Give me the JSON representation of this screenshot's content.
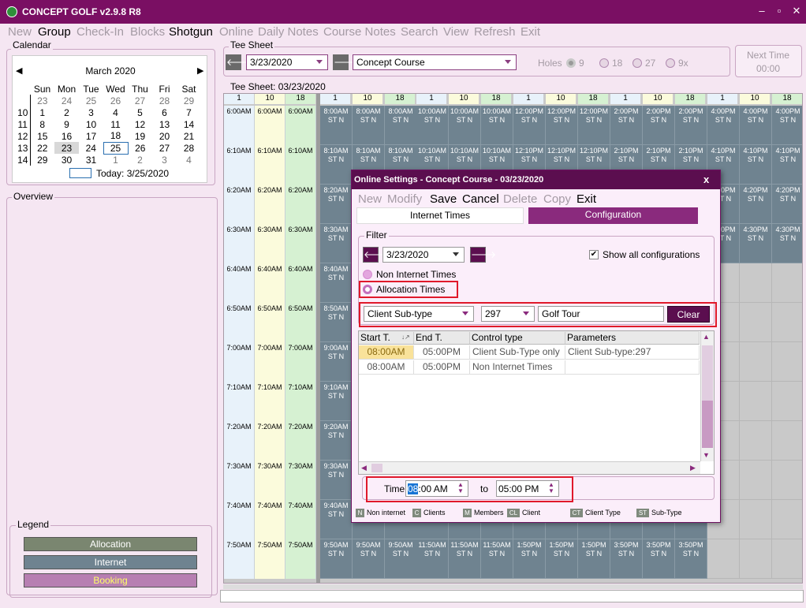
{
  "app": {
    "title": "CONCEPT GOLF v2.9.8 R8"
  },
  "menu": [
    {
      "label": "New",
      "enabled": false
    },
    {
      "label": "Group",
      "enabled": true
    },
    {
      "label": "Check-In",
      "enabled": false
    },
    {
      "label": "Blocks",
      "enabled": false
    },
    {
      "label": "Shotgun",
      "enabled": true
    },
    {
      "label": "Online",
      "enabled": false
    },
    {
      "label": "Daily Notes",
      "enabled": false
    },
    {
      "label": "Course Notes",
      "enabled": false
    },
    {
      "label": "Search",
      "enabled": false
    },
    {
      "label": "View",
      "enabled": false
    },
    {
      "label": "Refresh",
      "enabled": false
    },
    {
      "label": "Exit",
      "enabled": false
    }
  ],
  "calendar": {
    "label": "Calendar",
    "month": "March 2020",
    "weekdays": [
      "Sun",
      "Mon",
      "Tue",
      "Wed",
      "Thu",
      "Fri",
      "Sat"
    ],
    "weeks": [
      {
        "n": "",
        "d": [
          "23",
          "24",
          "25",
          "26",
          "27",
          "28",
          "29"
        ]
      },
      {
        "n": "10",
        "d": [
          "1",
          "2",
          "3",
          "4",
          "5",
          "6",
          "7"
        ]
      },
      {
        "n": "11",
        "d": [
          "8",
          "9",
          "10",
          "11",
          "12",
          "13",
          "14"
        ]
      },
      {
        "n": "12",
        "d": [
          "15",
          "16",
          "17",
          "18",
          "19",
          "20",
          "21"
        ]
      },
      {
        "n": "13",
        "d": [
          "22",
          "23",
          "24",
          "25",
          "26",
          "27",
          "28"
        ]
      },
      {
        "n": "14",
        "d": [
          "29",
          "30",
          "31",
          "1",
          "2",
          "3",
          "4"
        ]
      }
    ],
    "today": "Today: 3/25/2020"
  },
  "overview": {
    "label": "Overview"
  },
  "legend": {
    "label": "Legend",
    "items": [
      {
        "label": "Allocation",
        "color": "#7a8670",
        "text": "#ffffff"
      },
      {
        "label": "Internet",
        "color": "#6f8390",
        "text": "#ffffff"
      },
      {
        "label": "Booking",
        "color": "#b77fb2",
        "text": "#ffff66"
      }
    ]
  },
  "teesheet_bar": {
    "label": "Tee Sheet",
    "date": "3/23/2020",
    "course": "Concept Course",
    "holes_label": "Holes",
    "holes": [
      "9",
      "18",
      "27",
      "9x"
    ]
  },
  "next_time": {
    "label": "Next Time",
    "value": "00:00"
  },
  "grid": {
    "label": "Tee Sheet: 03/23/2020",
    "col_headers": [
      "1",
      "10",
      "18"
    ],
    "times": [
      "6:00AM",
      "6:10AM",
      "6:20AM",
      "6:30AM",
      "6:40AM",
      "6:50AM",
      "7:00AM",
      "7:10AM",
      "7:20AM",
      "7:30AM",
      "7:40AM",
      "7:50AM"
    ],
    "groups": [
      {
        "times": [
          "8:00AM",
          "8:10AM",
          "8:20AM",
          "8:30AM",
          "8:40AM",
          "8:50AM",
          "9:00AM",
          "9:10AM",
          "9:20AM",
          "9:30AM",
          "9:40AM",
          "9:50AM"
        ]
      },
      {
        "times": [
          "10:00AM",
          "10:10AM",
          "",
          "",
          "",
          "",
          "",
          "",
          "",
          "",
          "",
          "11:50AM"
        ]
      },
      {
        "times": [
          "12:00PM",
          "12:10PM",
          "",
          "",
          "",
          "",
          "",
          "",
          "",
          "",
          "",
          "1:50PM"
        ]
      },
      {
        "times": [
          "2:00PM",
          "2:10PM",
          "",
          "",
          "",
          "",
          "",
          "",
          "",
          "",
          "",
          "3:50PM"
        ]
      },
      {
        "times": [
          "4:00PM",
          "4:10PM",
          "4:20PM",
          "4:30PM",
          "",
          "",
          "",
          "",
          "",
          "",
          "",
          ""
        ]
      }
    ],
    "slot_code": "ST N"
  },
  "dialog": {
    "title": "Online Settings - Concept Course - 03/23/2020",
    "menu": [
      {
        "label": "New",
        "enabled": false
      },
      {
        "label": "Modify",
        "enabled": false
      },
      {
        "label": "Save",
        "enabled": true
      },
      {
        "label": "Cancel",
        "enabled": true
      },
      {
        "label": "Delete",
        "enabled": false
      },
      {
        "label": "Copy",
        "enabled": false
      },
      {
        "label": "Exit",
        "enabled": true
      }
    ],
    "tabs": [
      "Internet Times",
      "Configuration"
    ],
    "filter_label": "Filter",
    "date": "3/23/2020",
    "show_all": "Show all configurations",
    "radio_non": "Non Internet Times",
    "radio_alloc": "Allocation Times",
    "subtype_combo": "Client Sub-type",
    "code_combo": "297",
    "code_desc": "Golf Tour",
    "clear": "Clear",
    "table": {
      "headers": [
        "Start T.",
        "End T.",
        "Control type",
        "Parameters"
      ],
      "rows": [
        [
          "08:00AM",
          "05:00PM",
          "Client Sub-Type only",
          "Client Sub-type:297"
        ],
        [
          "08:00AM",
          "05:00PM",
          "Non Internet Times",
          ""
        ]
      ]
    },
    "time_label": "Time",
    "time_from_sel": "08",
    "time_from_rest": ":00 AM",
    "to_label": "to",
    "time_to": "05:00 PM",
    "badges": [
      {
        "code": "N",
        "label": "Non internet"
      },
      {
        "code": "C",
        "label": "Clients"
      },
      {
        "code": "M",
        "label": "Members"
      },
      {
        "code": "CL",
        "label": "Client"
      },
      {
        "code": "CT",
        "label": "Client Type"
      },
      {
        "code": "ST",
        "label": "Sub-Type"
      }
    ]
  }
}
